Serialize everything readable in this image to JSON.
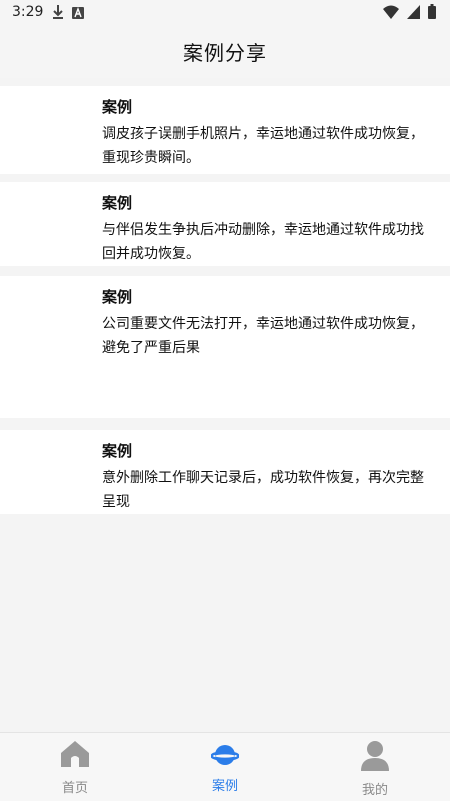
{
  "status_bar": {
    "time": "3:29",
    "left_icons": [
      "download-icon",
      "a-notification-icon"
    ],
    "right_icons": [
      "wifi-icon",
      "signal-icon",
      "battery-icon"
    ]
  },
  "header": {
    "title": "案例分享"
  },
  "cases": [
    {
      "title": "案例",
      "description": "调皮孩子误删手机照片，幸运地通过软件成功恢复，重现珍贵瞬间。"
    },
    {
      "title": "案例",
      "description": "与伴侣发生争执后冲动删除，幸运地通过软件成功找回并成功恢复。"
    },
    {
      "title": "案例",
      "description": "公司重要文件无法打开，幸运地通过软件成功恢复，避免了严重后果"
    },
    {
      "title": "案例",
      "description": "意外删除工作聊天记录后，成功软件恢复，再次完整呈现"
    }
  ],
  "tab_bar": {
    "tabs": [
      {
        "label": "首页",
        "icon": "home-icon",
        "active": false
      },
      {
        "label": "案例",
        "icon": "planet-icon",
        "active": true
      },
      {
        "label": "我的",
        "icon": "person-icon",
        "active": false
      }
    ],
    "active_color": "#2b7de9",
    "inactive_color": "#8a8a8a"
  }
}
